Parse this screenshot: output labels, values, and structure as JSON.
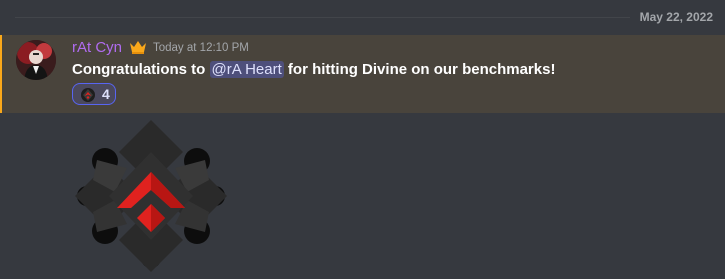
{
  "divider": {
    "date": "May 22, 2022"
  },
  "message": {
    "username": "rAt Cyn",
    "timestamp": "Today at 12:10 PM",
    "content_prefix": "Congratulations to ",
    "mention": "@rA Heart",
    "content_suffix": " for hitting Divine on our benchmarks!",
    "reaction_count": "4",
    "badge_icon": "crown-icon",
    "reaction_icon": "rank-emblem-emoji",
    "sticker_icon": "divine-rank-emblem"
  },
  "colors": {
    "background": "#36393f",
    "highlight": "#49443c",
    "highlight_border": "#faa81a",
    "username": "#b06cf0",
    "mention_bg": "#5865f2",
    "emblem_red": "#e0221f"
  }
}
